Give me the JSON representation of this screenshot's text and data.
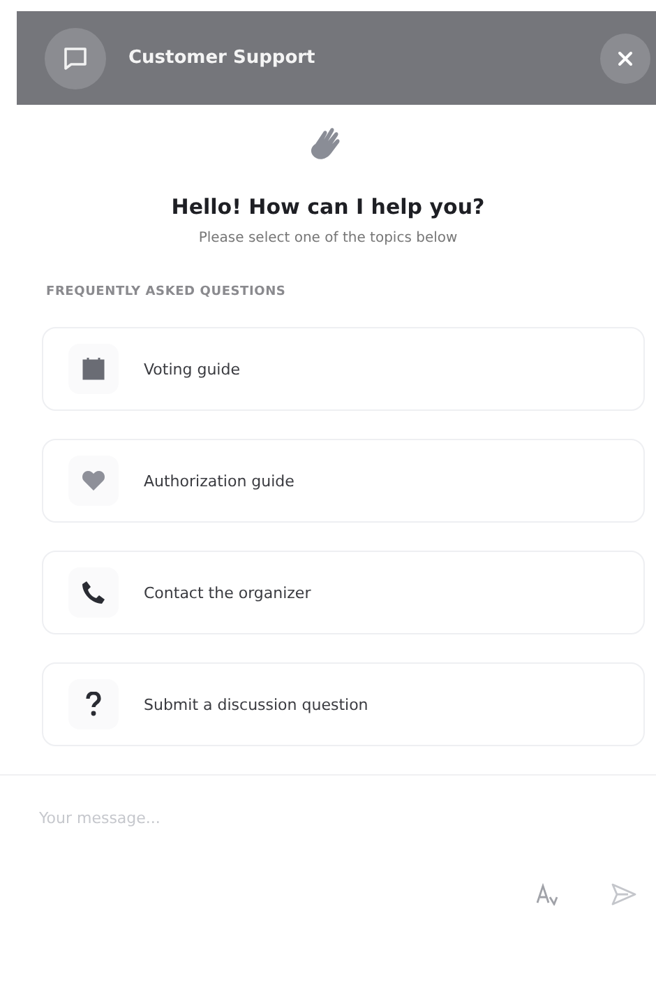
{
  "header": {
    "title": "Customer Support"
  },
  "greeting": {
    "title": "Hello! How can I help you?",
    "subtitle": "Please select one of the topics below"
  },
  "faq": {
    "heading": "FREQUENTLY ASKED QUESTIONS",
    "topics": [
      {
        "kind": "calendar",
        "label": "Voting guide"
      },
      {
        "kind": "heart",
        "label": "Authorization guide"
      },
      {
        "kind": "phone",
        "label": "Contact the organizer"
      },
      {
        "kind": "question",
        "label": "Submit a discussion question"
      }
    ]
  },
  "composer": {
    "placeholder": "Your message..."
  }
}
